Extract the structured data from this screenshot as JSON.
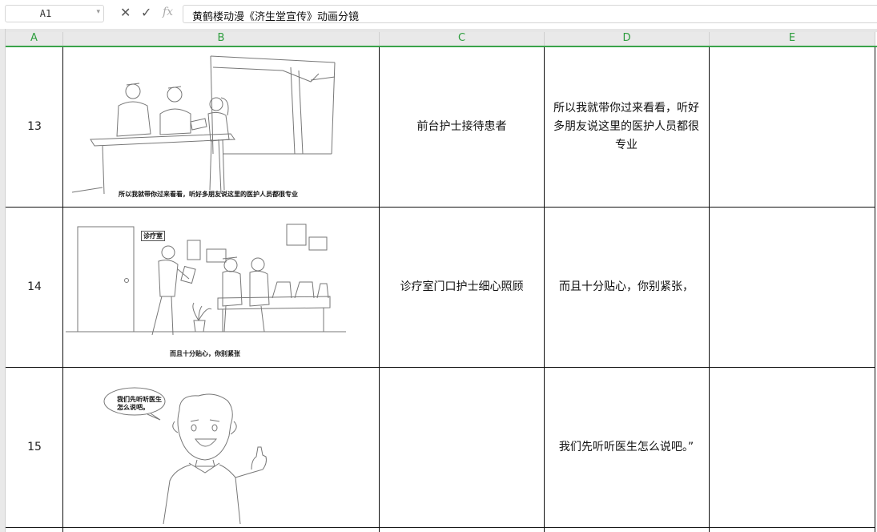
{
  "formula_bar": {
    "name_box": "A1",
    "formula": "黄鹤楼动漫《济生堂宣传》动画分镜"
  },
  "columns": [
    "A",
    "B",
    "C",
    "D",
    "E"
  ],
  "rows": [
    {
      "num": "13",
      "caption": "所以我就带你过来看看，听好多朋友说这里的医护人员都很专业",
      "scene": "前台护士接待患者",
      "dialogue": "所以我就带你过来看看，听好多朋友说这里的医护人员都很专业",
      "note": ""
    },
    {
      "num": "14",
      "sign": "诊疗室",
      "caption": "而且十分贴心，你别紧张",
      "scene": "诊疗室门口护士细心照顾",
      "dialogue": "而且十分贴心，你别紧张，",
      "note": ""
    },
    {
      "num": "15",
      "bubble": "我们先听听医生怎么说吧。",
      "scene": "",
      "dialogue": "我们先听听医生怎么说吧。”",
      "note": ""
    }
  ]
}
